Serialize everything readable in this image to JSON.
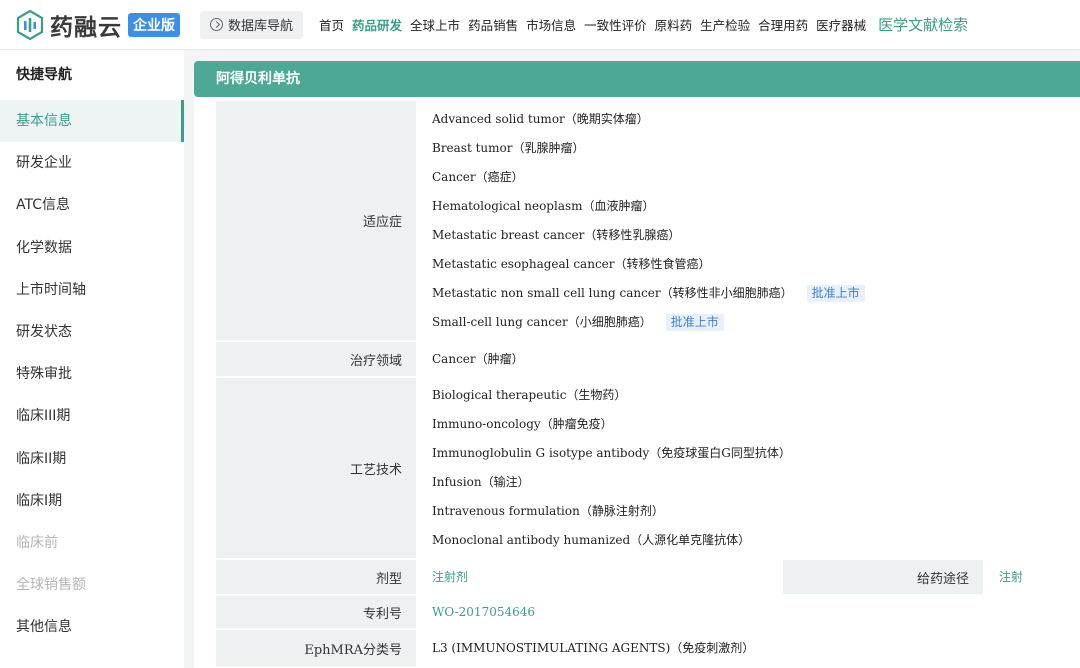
{
  "header": {
    "logo_text": "药融云",
    "logo_badge": "企业版",
    "db_nav_label": "数据库导航",
    "nav": [
      {
        "label": "首页"
      },
      {
        "label": "药品研发"
      },
      {
        "label": "全球上市"
      },
      {
        "label": "药品销售"
      },
      {
        "label": "市场信息"
      },
      {
        "label": "一致性评价"
      },
      {
        "label": "原料药"
      },
      {
        "label": "生产检验"
      },
      {
        "label": "合理用药"
      },
      {
        "label": "医疗器械"
      },
      {
        "label": "医学文献检索"
      }
    ],
    "active_nav": "药品研发"
  },
  "sidebar": {
    "title": "快捷导航",
    "items": [
      {
        "label": "基本信息"
      },
      {
        "label": "研发企业"
      },
      {
        "label": "ATC信息"
      },
      {
        "label": "化学数据"
      },
      {
        "label": "上市时间轴"
      },
      {
        "label": "研发状态"
      },
      {
        "label": "特殊审批"
      },
      {
        "label": "临床III期"
      },
      {
        "label": "临床II期"
      },
      {
        "label": "临床I期"
      },
      {
        "label": "临床前"
      },
      {
        "label": "全球销售额"
      },
      {
        "label": "其他信息"
      }
    ],
    "active_item": "基本信息",
    "disabled_items": [
      "临床前",
      "全球销售额"
    ]
  },
  "drug": {
    "name": "阿得贝利单抗",
    "indications_label": "适应症",
    "indications": [
      {
        "text": "Advanced solid tumor（晚期实体瘤）",
        "tag": ""
      },
      {
        "text": "Breast tumor（乳腺肿瘤）",
        "tag": ""
      },
      {
        "text": "Cancer（癌症）",
        "tag": ""
      },
      {
        "text": "Hematological neoplasm（血液肿瘤）",
        "tag": ""
      },
      {
        "text": "Metastatic breast cancer（转移性乳腺癌）",
        "tag": ""
      },
      {
        "text": "Metastatic esophageal cancer（转移性食管癌）",
        "tag": ""
      },
      {
        "text": "Metastatic non small cell lung cancer（转移性非小细胞肺癌）",
        "tag": "批准上市"
      },
      {
        "text": "Small-cell lung cancer（小细胞肺癌）",
        "tag": "批准上市"
      }
    ],
    "therapy_label": "治疗领域",
    "therapy": "Cancer（肿瘤）",
    "tech_label": "工艺技术",
    "tech": [
      "Biological therapeutic（生物药）",
      "Immuno-oncology（肿瘤免疫）",
      "Immunoglobulin G isotype antibody（免疫球蛋白G同型抗体）",
      "Infusion（输注）",
      "Intravenous formulation（静脉注射剂）",
      "Monoclonal antibody humanized（人源化单克隆抗体）"
    ],
    "dosage_label": "剂型",
    "dosage": "注射剂",
    "route_label": "给药途径",
    "route": "注射",
    "patent_label": "专利号",
    "patent": "WO-2017054646",
    "ephmra_label": "EphMRA分类号",
    "ephmra": "L3 (IMMUNOSTIMULATING AGENTS)（免疫刺激剂）"
  },
  "colors": {
    "accent": "#4da896",
    "accent_text": "#3a9e8a",
    "badge_blue": "#3d8ee8",
    "tag_bg": "#e8f0fb",
    "tag_text": "#3d7fd6"
  }
}
